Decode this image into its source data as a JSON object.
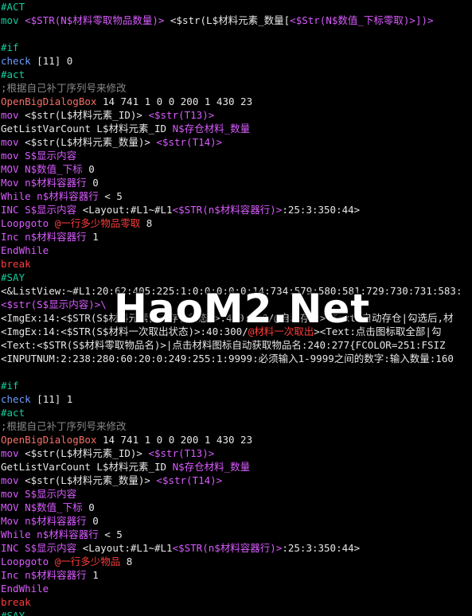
{
  "colors": {
    "keyword": "#13cc9c",
    "identifier": "#e7e7e7",
    "variable": "#d95bff",
    "comment": "#888888",
    "bigdialog": "#f76f66",
    "magenta": "#ff55ff",
    "red": "#ff3c3c",
    "blue": "#6c9cff",
    "white": "#ffffff",
    "gray": "#8a8a8a"
  },
  "watermark": "HaoM2.Net",
  "lines": [
    [
      [
        "#ACT",
        "keyword"
      ]
    ],
    [
      [
        "mov ",
        "keyword"
      ],
      [
        "<$STR(N$材料零取物品数量)>",
        "variable"
      ],
      [
        " <$str(L$材料元素_数量[",
        "identifier"
      ],
      [
        "<$Str(N$数值_下标零取)>",
        "variable"
      ],
      [
        "])>",
        "variable"
      ]
    ],
    [],
    [
      [
        "#if",
        "keyword"
      ]
    ],
    [
      [
        "check",
        "blue"
      ],
      [
        " [11] 0",
        "identifier"
      ]
    ],
    [
      [
        "#act",
        "keyword"
      ]
    ],
    [
      [
        ";根据自己补丁序列号来修改",
        "comment"
      ]
    ],
    [
      [
        "OpenBigDialogBox",
        "bigdialog"
      ],
      [
        " 14 741 1 0 0 200 1 430 23",
        "identifier"
      ]
    ],
    [
      [
        "mov",
        "variable"
      ],
      [
        " <$str(L$材料元素_ID)> ",
        "identifier"
      ],
      [
        "<$str(T13)>",
        "variable"
      ]
    ],
    [
      [
        "GetListVarCount",
        "identifier"
      ],
      [
        " L$材料元素_ID ",
        "identifier"
      ],
      [
        "N$存仓材料_数量",
        "variable"
      ]
    ],
    [
      [
        "mov",
        "variable"
      ],
      [
        " <$str(L$材料元素_数量)> ",
        "identifier"
      ],
      [
        "<$str(T14)>",
        "variable"
      ]
    ],
    [
      [
        "mov",
        "variable"
      ],
      [
        " S$显示内容",
        "variable"
      ]
    ],
    [
      [
        "MOV",
        "variable"
      ],
      [
        " N$数值_下标 ",
        "variable"
      ],
      [
        "0",
        "identifier"
      ]
    ],
    [
      [
        "Mov",
        "variable"
      ],
      [
        " n$材料容器行 ",
        "variable"
      ],
      [
        "0",
        "identifier"
      ]
    ],
    [
      [
        "While",
        "variable"
      ],
      [
        " n$材料容器行 ",
        "variable"
      ],
      [
        "< 5",
        "identifier"
      ]
    ],
    [
      [
        "INC",
        "variable"
      ],
      [
        " S$显示内容 ",
        "variable"
      ],
      [
        "<Layout:#L1~#L1",
        "identifier"
      ],
      [
        "<$STR(n$材料容器行)>",
        "variable"
      ],
      [
        ":25:3:350:44>",
        "identifier"
      ]
    ],
    [
      [
        "Loopgoto",
        "variable"
      ],
      [
        " @一行多少物品零取 ",
        "red"
      ],
      [
        "8",
        "identifier"
      ]
    ],
    [
      [
        "Inc",
        "variable"
      ],
      [
        " n$材料容器行 ",
        "variable"
      ],
      [
        "1",
        "identifier"
      ]
    ],
    [
      [
        "EndWhile",
        "variable"
      ]
    ],
    [
      [
        "break",
        "red"
      ]
    ],
    [
      [
        "#SAY",
        "keyword"
      ]
    ],
    [
      [
        "<&ListView:~#L1:20:62:405:225:1:0:0:0:0:0:14:734:579:580:581:729:730:731:583:",
        "identifier"
      ]
    ],
    [
      [
        "<$str(S$显示内容)>\\",
        "variable"
      ]
    ],
    [
      [
        "<ImgEx:14:<$STR(S$材料元素自动存仓状态)>:400:200/@自动存仓><Text:自动存仓|勾选后,材",
        "identifier"
      ]
    ],
    [
      [
        "<ImgEx:14:<$STR(S$材料一次取出状态)>:40:300/",
        "identifier"
      ],
      [
        "@材料一次取出",
        "red"
      ],
      [
        "><Text:点击图标取全部|勾",
        "identifier"
      ]
    ],
    [
      [
        "<Text:<$STR(S$材料零取物品名)>|点击材料图标自动获取物品名:240:277{FCOLOR=251:FSIZ",
        "identifier"
      ]
    ],
    [
      [
        "<INPUTNUM:2:238:280:60:20:0:249:255:1:9999:必须输入1-9999之间的数字:输入数量:160",
        "identifier"
      ]
    ],
    [],
    [
      [
        "#if",
        "keyword"
      ]
    ],
    [
      [
        "check",
        "blue"
      ],
      [
        " [11] 1",
        "identifier"
      ]
    ],
    [
      [
        "#act",
        "keyword"
      ]
    ],
    [
      [
        ";根据自己补丁序列号来修改",
        "comment"
      ]
    ],
    [
      [
        "OpenBigDialogBox",
        "bigdialog"
      ],
      [
        " 14 741 1 0 0 200 1 430 23",
        "identifier"
      ]
    ],
    [
      [
        "mov",
        "variable"
      ],
      [
        " <$str(L$材料元素_ID)> ",
        "identifier"
      ],
      [
        "<$str(T13)>",
        "variable"
      ]
    ],
    [
      [
        "GetListVarCount",
        "identifier"
      ],
      [
        " L$材料元素_ID ",
        "identifier"
      ],
      [
        "N$存仓材料_数量",
        "variable"
      ]
    ],
    [
      [
        "mov",
        "variable"
      ],
      [
        " <$str(L$材料元素_数量)> ",
        "identifier"
      ],
      [
        "<$str(T14)>",
        "variable"
      ]
    ],
    [
      [
        "mov",
        "variable"
      ],
      [
        " S$显示内容",
        "variable"
      ]
    ],
    [
      [
        "MOV",
        "variable"
      ],
      [
        " N$数值_下标 ",
        "variable"
      ],
      [
        "0",
        "identifier"
      ]
    ],
    [
      [
        "Mov",
        "variable"
      ],
      [
        " n$材料容器行 ",
        "variable"
      ],
      [
        "0",
        "identifier"
      ]
    ],
    [
      [
        "While",
        "variable"
      ],
      [
        " n$材料容器行 ",
        "variable"
      ],
      [
        "< 5",
        "identifier"
      ]
    ],
    [
      [
        "INC",
        "variable"
      ],
      [
        " S$显示内容 ",
        "variable"
      ],
      [
        "<Layout:#L1~#L1",
        "identifier"
      ],
      [
        "<$STR(n$材料容器行)>",
        "variable"
      ],
      [
        ":25:3:350:44>",
        "identifier"
      ]
    ],
    [
      [
        "Loopgoto",
        "variable"
      ],
      [
        " @一行多少物品 ",
        "red"
      ],
      [
        "8",
        "identifier"
      ]
    ],
    [
      [
        "Inc",
        "variable"
      ],
      [
        " n$材料容器行 ",
        "variable"
      ],
      [
        "1",
        "identifier"
      ]
    ],
    [
      [
        "EndWhile",
        "variable"
      ]
    ],
    [
      [
        "break",
        "red"
      ]
    ],
    [
      [
        "#SAY",
        "keyword"
      ]
    ]
  ]
}
